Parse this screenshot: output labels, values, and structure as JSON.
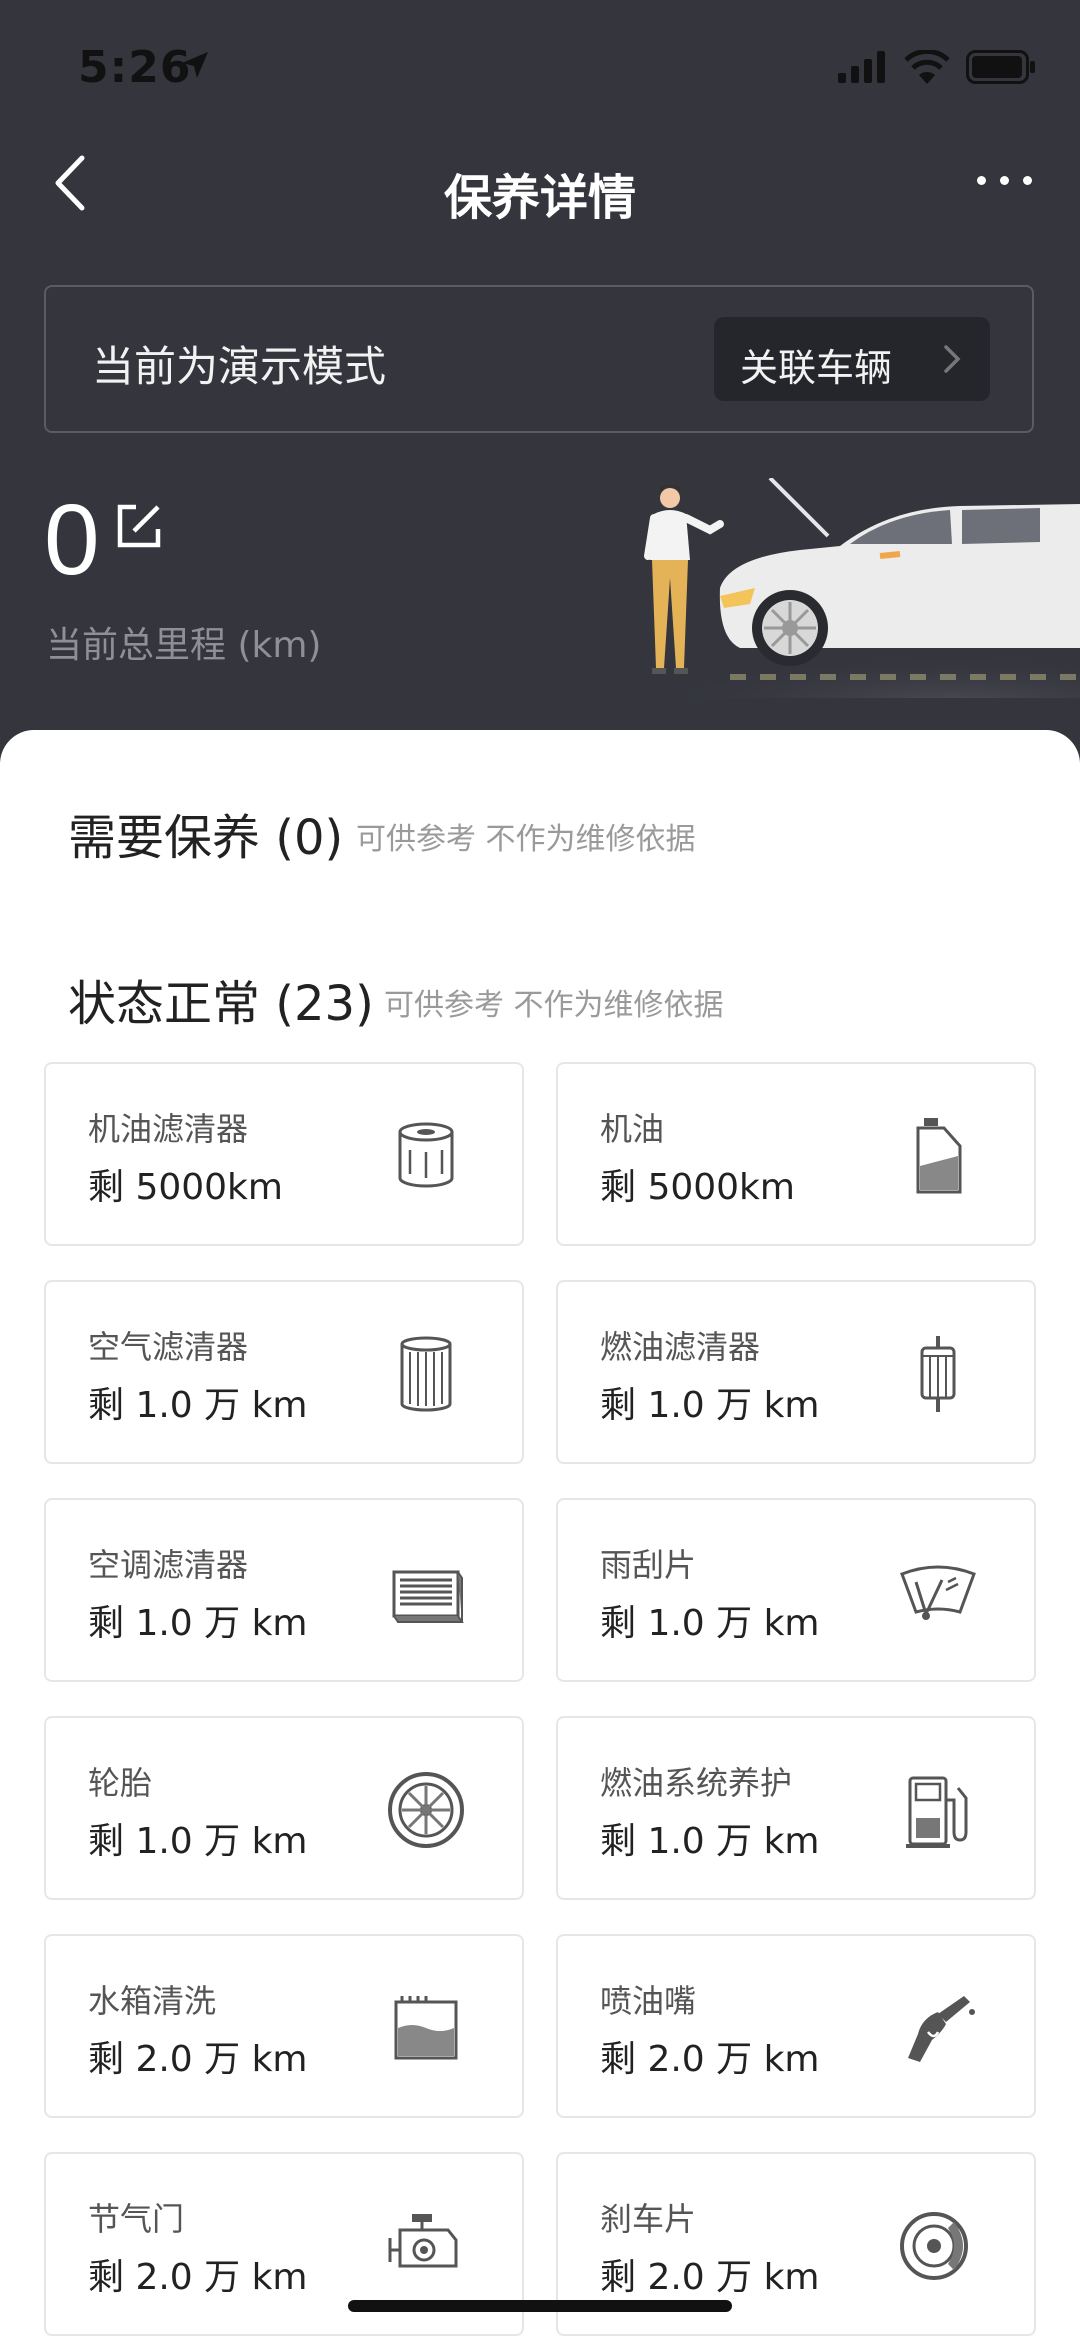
{
  "status_bar": {
    "time": "5:26"
  },
  "nav": {
    "title": "保养详情"
  },
  "demo_banner": {
    "text": "当前为演示模式",
    "button_label": "关联车辆"
  },
  "mileage": {
    "value": "0",
    "label": "当前总里程 (km)"
  },
  "sections": {
    "need_maintenance": {
      "title": "需要保养 (0)",
      "note": "可供参考 不作为维修依据"
    },
    "normal": {
      "title": "状态正常 (23)",
      "note": "可供参考 不作为维修依据"
    }
  },
  "items": [
    {
      "name": "机油滤清器",
      "remaining": "剩 5000km",
      "icon": "oil-filter-icon"
    },
    {
      "name": "机油",
      "remaining": "剩 5000km",
      "icon": "engine-oil-icon"
    },
    {
      "name": "空气滤清器",
      "remaining": "剩 1.0 万 km",
      "icon": "air-filter-icon"
    },
    {
      "name": "燃油滤清器",
      "remaining": "剩 1.0 万 km",
      "icon": "fuel-filter-icon"
    },
    {
      "name": "空调滤清器",
      "remaining": "剩 1.0 万 km",
      "icon": "ac-filter-icon"
    },
    {
      "name": "雨刮片",
      "remaining": "剩 1.0 万 km",
      "icon": "wiper-icon"
    },
    {
      "name": "轮胎",
      "remaining": "剩 1.0 万 km",
      "icon": "tire-icon"
    },
    {
      "name": "燃油系统养护",
      "remaining": "剩 1.0 万 km",
      "icon": "fuel-pump-icon"
    },
    {
      "name": "水箱清洗",
      "remaining": "剩 2.0 万 km",
      "icon": "radiator-icon"
    },
    {
      "name": "喷油嘴",
      "remaining": "剩 2.0 万 km",
      "icon": "fuel-nozzle-icon"
    },
    {
      "name": "节气门",
      "remaining": "剩 2.0 万 km",
      "icon": "throttle-icon"
    },
    {
      "name": "刹车片",
      "remaining": "剩 2.0 万 km",
      "icon": "brake-disc-icon"
    }
  ]
}
